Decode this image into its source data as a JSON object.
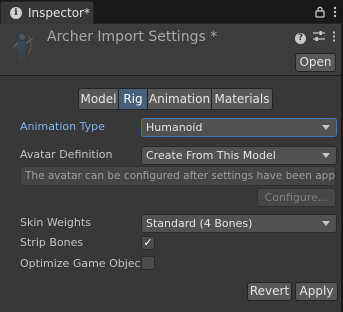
{
  "tab": {
    "label": "Inspector*"
  },
  "header": {
    "title": "Archer Import Settings *",
    "open_label": "Open"
  },
  "toolbar": {
    "tabs": [
      {
        "label": "Model",
        "active": false
      },
      {
        "label": "Rig",
        "active": true
      },
      {
        "label": "Animation",
        "active": false
      },
      {
        "label": "Materials",
        "active": false
      }
    ]
  },
  "rig": {
    "animation_type": {
      "label": "Animation Type",
      "value": "Humanoid"
    },
    "avatar_definition": {
      "label": "Avatar Definition",
      "value": "Create From This Model"
    },
    "help_text": "The avatar can be configured after settings have been applied.",
    "configure_label": "Configure...",
    "skin_weights": {
      "label": "Skin Weights",
      "value": "Standard (4 Bones)"
    },
    "strip_bones": {
      "label": "Strip Bones",
      "checked": true,
      "mark": "✓"
    },
    "optimize_game_object": {
      "label": "Optimize Game Object",
      "checked": false
    }
  },
  "footer": {
    "revert_label": "Revert",
    "apply_label": "Apply"
  },
  "colors": {
    "background": "#383838",
    "active_tab": "#46607c",
    "highlight_label": "#7fb2ee",
    "focus_border": "#3a79bb"
  }
}
